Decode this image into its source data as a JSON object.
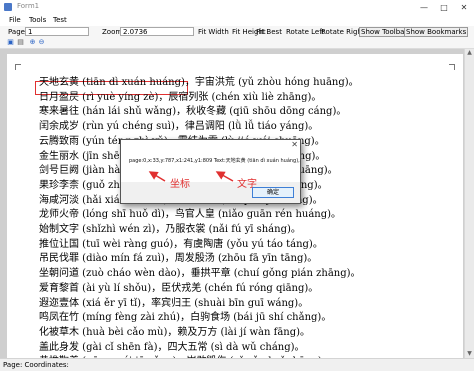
{
  "window": {
    "title": "Form1",
    "controls": [
      "—",
      "□",
      "✕"
    ]
  },
  "menu": {
    "items": [
      "File",
      "Tools",
      "Test"
    ]
  },
  "toolbar": {
    "page_label": "Page:",
    "page_value": "1",
    "zoom_label": "Zoom:",
    "zoom_value": "2.0736",
    "buttons": [
      "Fit Width",
      "Fit Height",
      "Fit Best",
      "Rotate Left",
      "Rotate Right",
      "Show Toolbar",
      "Show Bookmarks"
    ]
  },
  "document": {
    "lines": [
      "天地玄黄 (tiān dì xuán huáng)，宇宙洪荒 (yǔ zhòu hóng huāng)。",
      "日月盈昃 (rì yuè yíng zè)，辰宿列张 (chén xiù liè zhāng)。",
      "寒来暑往 (hán lái shǔ wǎng)，秋收冬藏 (qiū shōu dōng cáng)。",
      "闰余成岁 (rùn yú chéng suì)，律吕调阳 (lǜ lǚ tiáo yáng)。",
      "云腾致雨 (yún téng zhì yǔ)，露结为霜 (lù jié wéi shuāng)。",
      "金生丽水 (jīn shēng lì shuǐ)，玉出昆冈 (yù chū kūn gāng)。",
      "剑号巨阙 (jiàn hào jù què)，珠称夜光 (zhū chēng yè guāng)。",
      "果珍李柰 (guǒ zhēn lǐ nài)，菜重芥姜 (cài zhòng jiè jiāng)。",
      "海咸河淡 (hǎi xián hé dàn)，鳞潜羽翔 (lín qián yǔ xiáng)。",
      "龙师火帝 (lóng shī huǒ dì)，鸟官人皇 (niǎo guān rén huáng)。",
      "始制文字 (shǐzhì wén zì)，乃服衣裳 (nǎi fú yī sháng)。",
      "推位让国 (tuī wèi ràng guó)，有虞陶唐 (yǒu yú táo táng)。",
      "吊民伐罪 (diào mín fá zuì)，周发殷汤 (zhōu fā yīn tāng)。",
      "坐朝问道 (zuò cháo wèn dào)，垂拱平章 (chuí gǒng pián zhāng)。",
      "爱育黎首 (ài yù lí shǒu)，臣伏戎羌 (chén fú róng qiāng)。",
      "遐迩壹体 (xiá ěr yī tǐ)，率宾归王 (shuài bīn guī wáng)。",
      "鸣凤在竹 (míng fèng zài zhú)，白驹食场 (bái jū shí chǎng)。",
      "化被草木 (huà bèi cǎo mù)，赖及万方 (lài jí wàn fāng)。",
      "盖此身发 (gài cǐ shēn fà)，四大五常 (sì dà wǔ cháng)。",
      "恭惟鞠养 (gōng wéi jū yǎng)，岂敢毁伤 (qǐ gǎn huǐ shāng)。"
    ]
  },
  "dialog": {
    "message": "page:0,x:33,y:787,x1:241,y1:809 Text:天地玄黄 (tiān dì xuán huáng),",
    "close_glyph": "✕",
    "ok_label": "确定"
  },
  "annotations": {
    "coordinates": "坐标",
    "text": "文字",
    "color": "#e03030"
  },
  "statusbar": {
    "text": "Page:  Coordinates:"
  }
}
